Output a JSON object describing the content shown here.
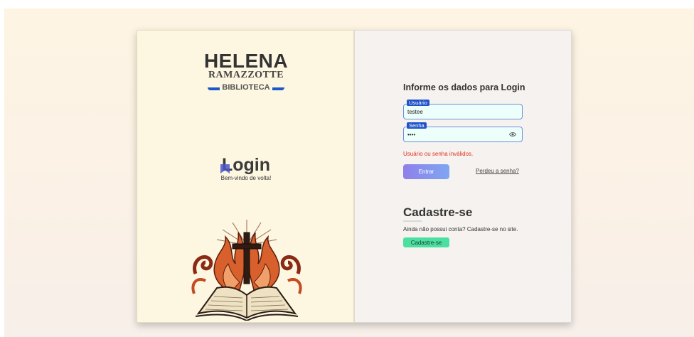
{
  "brand": {
    "line1": "HELENA",
    "line2": "RAMAZZOTTE",
    "line3": "BIBLIOTECA",
    "accent_color": "#1d56c7"
  },
  "hero": {
    "title": "Login",
    "subtitle": "Bem-vindo de volta!"
  },
  "illustration": {
    "name": "bible-cross-flames-illustration"
  },
  "login_form": {
    "title": "Informe os dados para Login",
    "username_label": "Usuário",
    "username_value": "testee",
    "password_label": "Senha",
    "password_value": "••••",
    "password_icon": "eye-icon",
    "error_message": "Usuário ou senha inválidos.",
    "submit_label": "Entrar",
    "forgot_link": "Perdeu a senha?"
  },
  "register": {
    "title": "Cadastre-se",
    "text": "Ainda não possui conta? Cadastre-se no site.",
    "button_label": "Cadastre-se",
    "button_color": "#4be0a0"
  },
  "colors": {
    "error": "#e3301f",
    "field_border": "#6f8fd8",
    "field_bg": "#ecfffb",
    "label_bg": "#1f53c8"
  }
}
